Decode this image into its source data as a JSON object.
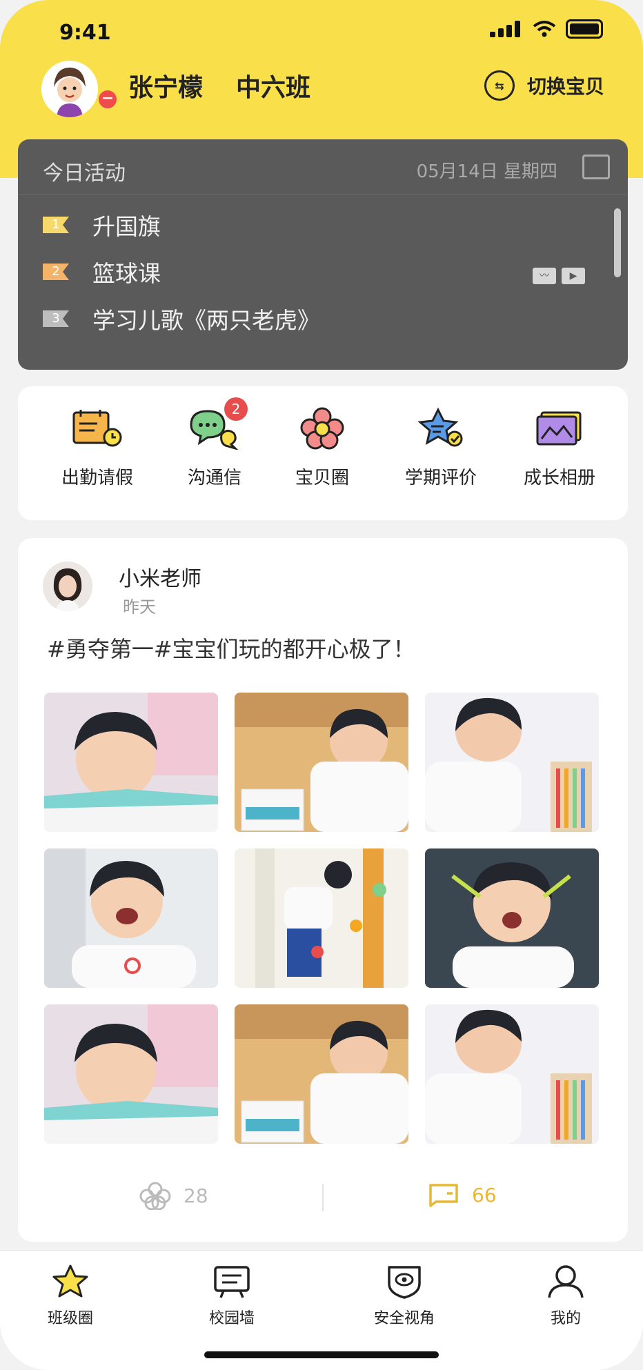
{
  "status_bar": {
    "time": "9:41"
  },
  "header": {
    "child_name": "张宁檬",
    "class_name": "中六班",
    "switch_label": "切换宝贝"
  },
  "activity": {
    "title": "今日活动",
    "date": "05月14日 星期四",
    "items": [
      {
        "num": "1",
        "label": "升国旗",
        "flag_color": "#f6d86b"
      },
      {
        "num": "2",
        "label": "篮球课",
        "flag_color": "#f3b46a"
      },
      {
        "num": "3",
        "label": "学习儿歌《两只老虎》",
        "flag_color": "#bdbdbd"
      }
    ]
  },
  "shortcuts": [
    {
      "label": "出勤请假",
      "icon": "attendance-icon"
    },
    {
      "label": "沟通信",
      "icon": "chat-icon",
      "badge": "2"
    },
    {
      "label": "宝贝圈",
      "icon": "baby-circle-icon"
    },
    {
      "label": "学期评价",
      "icon": "star-rating-icon"
    },
    {
      "label": "成长相册",
      "icon": "album-icon"
    }
  ],
  "post": {
    "author": "小米老师",
    "time": "昨天",
    "text": "#勇夺第一#宝宝们玩的都开心极了！",
    "likes": "28",
    "comments": "66"
  },
  "tabs": [
    {
      "label": "班级圈",
      "icon": "star-icon"
    },
    {
      "label": "校园墙",
      "icon": "board-icon"
    },
    {
      "label": "安全视角",
      "icon": "eye-shield-icon"
    },
    {
      "label": "我的",
      "icon": "user-icon"
    }
  ],
  "colors": {
    "brand_yellow": "#f9e04b",
    "accent_gold": "#e8b830",
    "badge_red": "#e84d4d",
    "activity_bg": "#5a5a5a"
  }
}
